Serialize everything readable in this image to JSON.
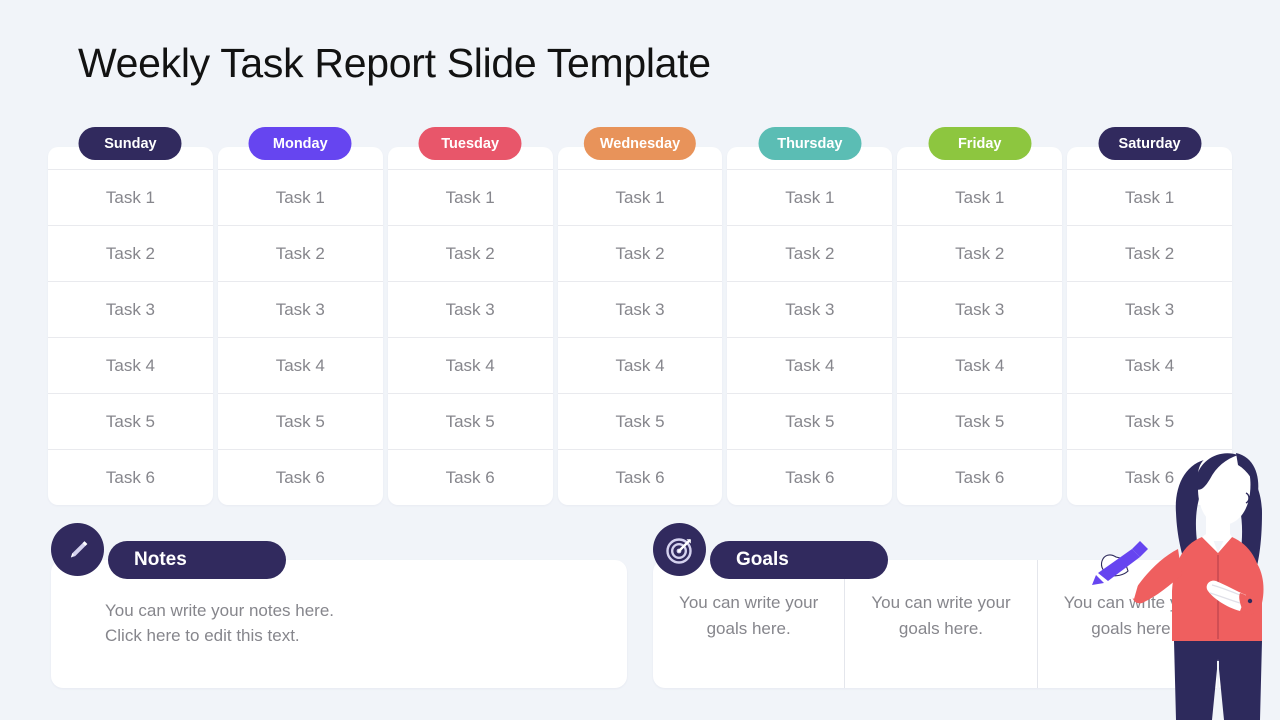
{
  "page": {
    "title": "Weekly Task Report Slide Template",
    "background_color": "#f1f4f9"
  },
  "week": {
    "days": [
      {
        "label": "Sunday",
        "color": "#312a5e"
      },
      {
        "label": "Monday",
        "color": "#6645f0"
      },
      {
        "label": "Tuesday",
        "color": "#e8566a"
      },
      {
        "label": "Wednesday",
        "color": "#e8935a"
      },
      {
        "label": "Thursday",
        "color": "#5bbdb4"
      },
      {
        "label": "Friday",
        "color": "#8dc63f"
      },
      {
        "label": "Saturday",
        "color": "#312a5e"
      }
    ],
    "tasks": [
      "Task 1",
      "Task 2",
      "Task 3",
      "Task 4",
      "Task 5",
      "Task 6"
    ]
  },
  "notes": {
    "icon": "pencil-icon",
    "heading": "Notes",
    "line1": "You can write your notes here.",
    "line2": "Click here to edit this text."
  },
  "goals": {
    "icon": "target-icon",
    "heading": "Goals",
    "columns": [
      "You can write your goals here.",
      "You can write your goals here.",
      "You can write your goals here."
    ]
  },
  "illustration": {
    "name": "woman-with-marker-illustration",
    "hair_color": "#2d2a5c",
    "shirt_color": "#ef5f5f",
    "pants_color": "#2d2a5c",
    "marker_color": "#6645f0",
    "skin_color": "#ffffff"
  }
}
